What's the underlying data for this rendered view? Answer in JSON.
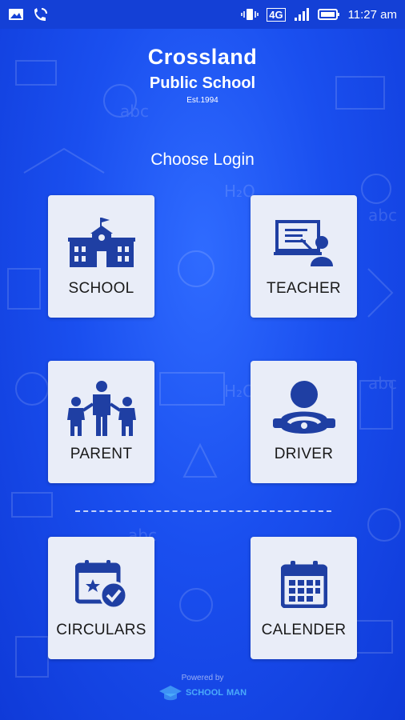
{
  "status_bar": {
    "time": "11:27 am",
    "network": "4G",
    "icons": [
      "image-icon",
      "wifi-call-icon",
      "vibrate-icon",
      "signal-icon",
      "battery-icon"
    ]
  },
  "header": {
    "title": "Crossland",
    "subtitle": "Public School",
    "established": "Est.1994"
  },
  "choose_login": "Choose Login",
  "tiles": [
    {
      "label": "SCHOOL",
      "icon": "school-building-icon"
    },
    {
      "label": "TEACHER",
      "icon": "teacher-board-icon"
    },
    {
      "label": "PARENT",
      "icon": "family-icon"
    },
    {
      "label": "DRIVER",
      "icon": "driver-steering-icon"
    },
    {
      "label": "CIRCULARS",
      "icon": "calendar-star-check-icon"
    },
    {
      "label": "CALENDER",
      "icon": "calendar-grid-icon"
    }
  ],
  "footer": {
    "powered_by": "Powered by",
    "brand_left": "SCHOOL",
    "brand_right": "MAN"
  },
  "colors": {
    "background": "#1a4fef",
    "icon": "#1f3fa3",
    "tile": "#e9edf8",
    "brand": "#58c4ff"
  }
}
